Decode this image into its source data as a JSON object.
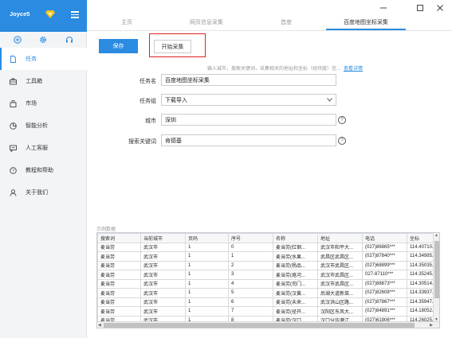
{
  "user": {
    "name": "Joyce5"
  },
  "sidebar": {
    "tools": [
      {
        "icon": "plus-circle-icon"
      },
      {
        "icon": "gear-icon"
      },
      {
        "icon": "headset-icon"
      }
    ],
    "items": [
      {
        "label": "任务",
        "icon": "document-icon",
        "active": true
      },
      {
        "label": "工具箱",
        "icon": "toolbox-icon"
      },
      {
        "label": "市场",
        "icon": "bag-icon"
      },
      {
        "label": "智能分析",
        "icon": "pie-chart-icon"
      },
      {
        "label": "人工客服",
        "icon": "chat-icon"
      },
      {
        "label": "教程和帮助",
        "icon": "help-icon"
      },
      {
        "label": "关于我们",
        "icon": "person-icon"
      }
    ]
  },
  "tabs": [
    {
      "label": "主页"
    },
    {
      "label": "网页信息采集"
    },
    {
      "label": "首度"
    },
    {
      "label": "百度地图坐标采集",
      "active": true
    }
  ],
  "toolbar": {
    "save_label": "保存",
    "start_label": "开始采集"
  },
  "hint": {
    "text": "输入城市，搜索关键词，采集相关的地址和坐标（经纬度）信...",
    "link": "查看详情"
  },
  "form": {
    "task_name_label": "任务名",
    "task_name_value": "百度地图坐标采集",
    "task_group_label": "任务组",
    "task_group_value": "下载导入",
    "city_label": "城市",
    "city_value": "深圳",
    "keyword_label": "搜索关键词",
    "keyword_value": "肯德基"
  },
  "sample": {
    "label": "示例数据",
    "columns": [
      "搜索词",
      "当前城市",
      "页码",
      "序号",
      "名称",
      "地址",
      "电话",
      "坐标"
    ],
    "rows": [
      [
        "麦当劳",
        "武汉市",
        "1",
        "0",
        "麦当劳(红钢...",
        "武汉市和平大...",
        "(027)86865***",
        "114.40710..."
      ],
      [
        "麦当劳",
        "武汉市",
        "1",
        "1",
        "麦当劳(水果...",
        "武昌区武昌区...",
        "(027)87840***",
        "114.34985..."
      ],
      [
        "麦当劳",
        "武汉市",
        "1",
        "2",
        "麦当劳(杨品...",
        "武汉市武昌区...",
        "(027)68899***",
        "114.35035..."
      ],
      [
        "麦当劳",
        "武汉市",
        "1",
        "3",
        "麦当劳(珞河...",
        "武汉市武昌区...",
        "027-87110***",
        "114.35245..."
      ],
      [
        "麦当劳",
        "武汉市",
        "1",
        "4",
        "麦当劳(司门...",
        "武汉市武昌区...",
        "(027)88873***",
        "114.30514..."
      ],
      [
        "麦当劳",
        "武汉市",
        "1",
        "5",
        "麦当劳(汉黄...",
        "后湖大道新菜...",
        "(027)82608***",
        "114.33937..."
      ],
      [
        "麦当劳",
        "武汉市",
        "1",
        "6",
        "麦当劳(未来...",
        "武汉洪山区路...",
        "(027)87867***",
        "114.35947..."
      ],
      [
        "麦当劳",
        "武汉市",
        "1",
        "7",
        "麦当劳(径开...",
        "汉阳区东风大...",
        "(027)84891***",
        "114.18052..."
      ],
      [
        "麦当劳",
        "武汉市",
        "1",
        "8",
        "麦当劳(汉口...",
        "汉口分华港江...",
        "(027)61906***",
        "114.26025..."
      ]
    ]
  },
  "colors": {
    "accent": "#2a8be0",
    "highlight": "#e02020"
  }
}
